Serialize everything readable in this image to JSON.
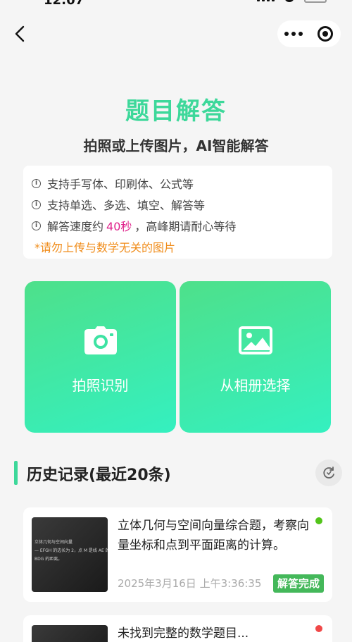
{
  "status_bar": {
    "time": "12:07"
  },
  "page": {
    "title": "题目解答",
    "subtitle": "拍照或上传图片，AI智能解答"
  },
  "tips": {
    "items": [
      "支持手写体、印刷体、公式等",
      "支持单选、多选、填空、解答等"
    ],
    "speed_prefix": "解答速度约",
    "speed_value": "40秒",
    "speed_suffix": "，高峰期请耐心等待",
    "warning": "*请勿上传与数学无关的图片"
  },
  "actions": {
    "camera_label": "拍照识别",
    "album_label": "从相册选择"
  },
  "history": {
    "title": "历史记录(最近20条)",
    "records": [
      {
        "title": "立体几何与空间向量综合题，考察向量坐标和点到平面距离的计算。",
        "time": "2025年3月16日 上午3:36:35",
        "status": "解答完成",
        "dot_color": "#52c41a",
        "thumb_lines": [
          "立体几何与空间向量",
          "— EFGH 的边长为 2，点 M 是线 AE 的中点",
          "",
          "",
          "BDG 的距离。"
        ]
      },
      {
        "title": "未找到完整的数学题目...",
        "dot_color": "#f04848"
      }
    ]
  },
  "colors": {
    "accent": "#3dd89a",
    "highlight": "#e0208a",
    "warning": "#f08c1a",
    "badge": "#44b85a"
  }
}
